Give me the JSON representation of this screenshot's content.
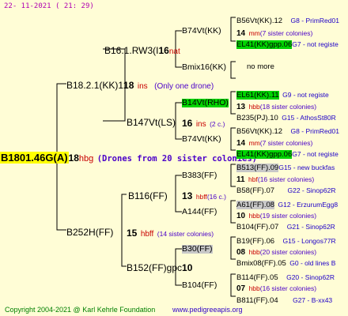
{
  "header": {
    "timestamp": "22- 11-2021 ( 21: 29)"
  },
  "root": {
    "name": "B1801.46G(A)",
    "num": "18",
    "cls": "hbg",
    "note": "(Drones from 20 sister colonies)"
  },
  "gen1": {
    "top": {
      "name": "B18.2.1(KK)1",
      "num": "18",
      "cls": "ins",
      "note": "(Only one drone)"
    },
    "bottom": {
      "name": "B252H(FF)",
      "num": "15",
      "cls": "hbff",
      "note": "(14 sister colonies)"
    }
  },
  "gen2": [
    {
      "name": "B16.1.RW3(I",
      "num": "16",
      "cls": "nat"
    },
    {
      "name": "B147Vt(LS)",
      "num": "16",
      "cls": "ins",
      "note": "(2 c.)"
    },
    {
      "name": "B116(FF)",
      "num": "13",
      "cls": "hbff",
      "note": "(16 c.)"
    },
    {
      "name": "B152(FF)gpc",
      "num": "10",
      "cls": "",
      "note": ""
    }
  ],
  "gen3": [
    {
      "name": "B74Vt(KK)"
    },
    {
      "name": "Bmix16(KK)"
    },
    {
      "name": "B14Vt(RHO)"
    },
    {
      "name": "B74Vt(KK)"
    },
    {
      "name": "B383(FF)"
    },
    {
      "name": "A144(FF)"
    },
    {
      "name": "B30(FF)"
    },
    {
      "name": "B104(FF)"
    }
  ],
  "gen4": [
    {
      "name": "B56Vt(KK).12",
      "region": "G8 - PrimRed01"
    },
    {
      "num": "14",
      "cls": "mm",
      "note": "(7 sister colonies)"
    },
    {
      "name": "EL41(KK)gpp.06",
      "region": "G7 - not registe"
    },
    {
      "name": "no more"
    },
    {
      "name": "EL61(KK).11",
      "region": "G9 - not registe"
    },
    {
      "num": "13",
      "cls": "hbb",
      "note": "(18 sister colonies)"
    },
    {
      "name": "B235(PJ).10",
      "region": "G15 - AthosSt80R"
    },
    {
      "name": "B56Vt(KK).12",
      "region": "G8 - PrimRed01"
    },
    {
      "num": "14",
      "cls": "mm",
      "note": "(7 sister colonies)"
    },
    {
      "name": "EL41(KK)gpp.06",
      "region": "G7 - not registe"
    },
    {
      "name": "B513(FF).09",
      "region": "G15 - new buckfas"
    },
    {
      "num": "11",
      "cls": "hbf",
      "note": "(16 sister colonies)"
    },
    {
      "name": "B58(FF).07",
      "region": "G22 - Sinop62R"
    },
    {
      "name": "A61(FF).08",
      "region": "G12 - ErzurumEgg8"
    },
    {
      "num": "10",
      "cls": "hbb",
      "note": "(19 sister colonies)"
    },
    {
      "name": "B104(FF).07",
      "region": "G21 - Sinop62R"
    },
    {
      "name": "B19(FF).06",
      "region": "G15 - Longos77R"
    },
    {
      "num": "08",
      "cls": "hbb",
      "note": "(20 sister colonies)"
    },
    {
      "name": "Bmix08(FF).05",
      "region": "G0 - old lines B"
    },
    {
      "name": "B114(FF).05",
      "region": "G20 - Sinop62R"
    },
    {
      "num": "07",
      "cls": "hbb",
      "note": "(16 sister colonies)"
    },
    {
      "name": "B811(FF).04",
      "region": "G27 - B-xx43"
    }
  ],
  "footer": {
    "copyright": "Copyright 2004-2021 @ Karl Kehrle Foundation",
    "site": "www.pedigreeapis.org"
  }
}
